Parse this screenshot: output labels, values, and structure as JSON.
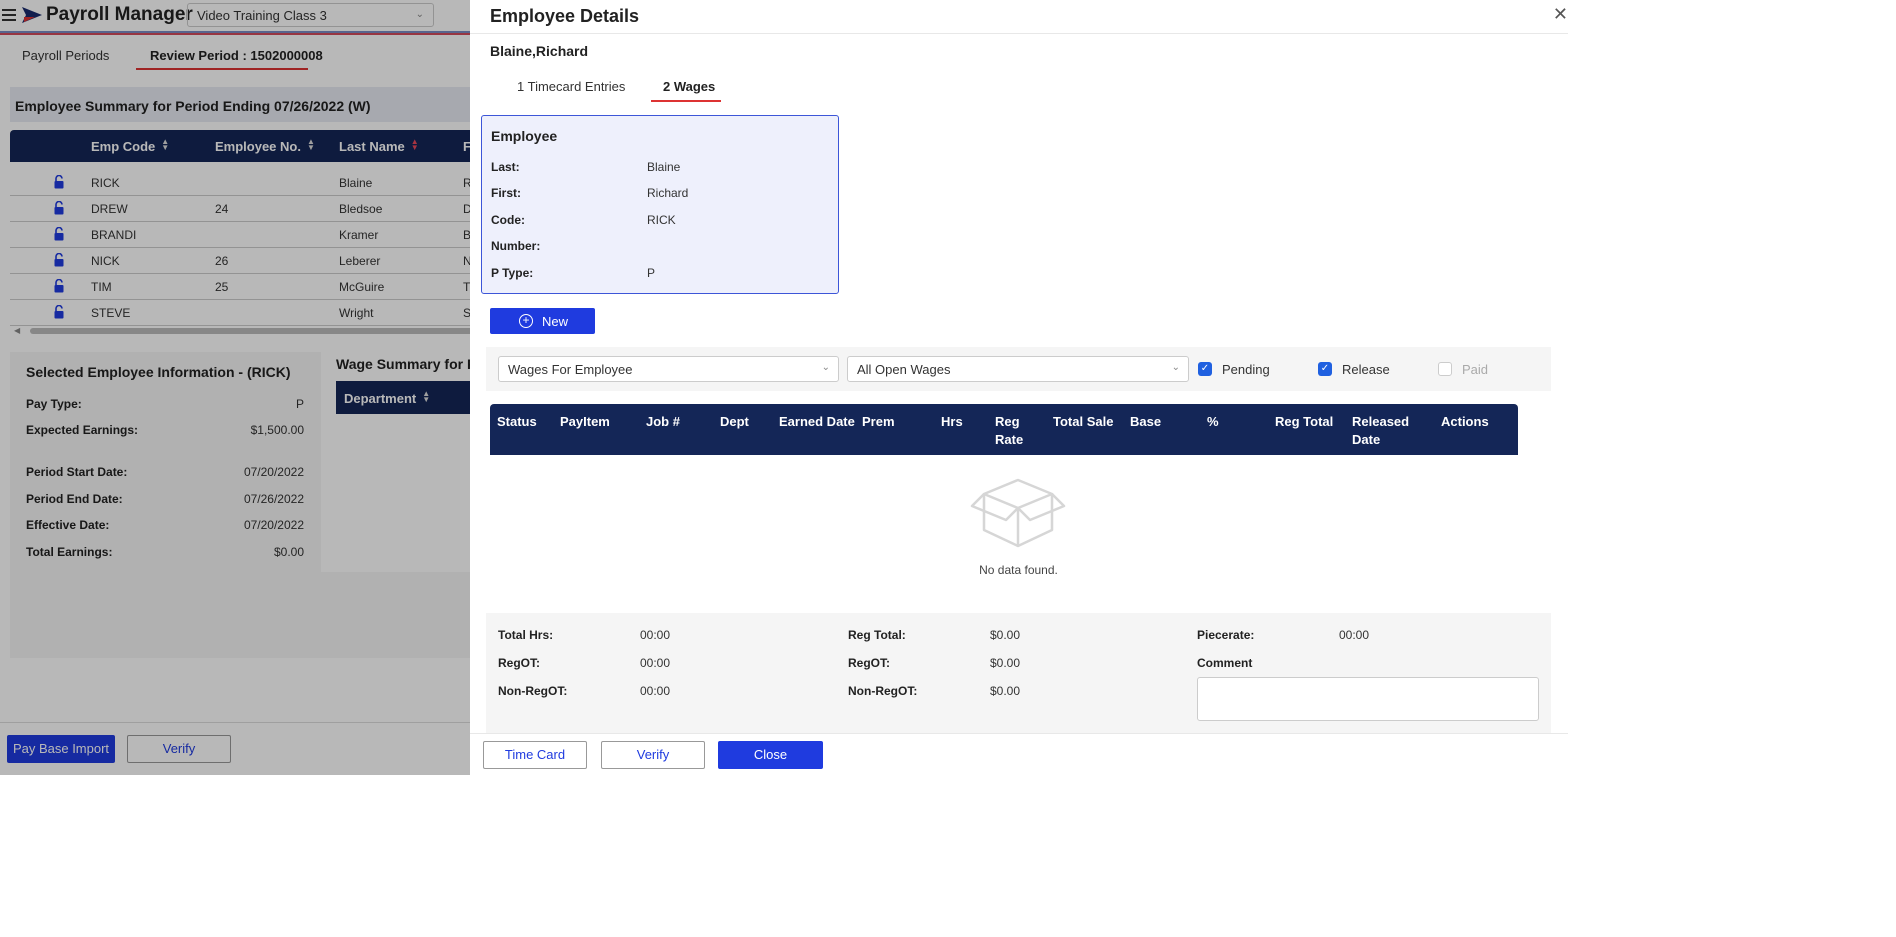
{
  "app": {
    "title": "Payroll Manager",
    "company_select": "Video Training Class 3"
  },
  "period_tabs": [
    {
      "label": "Payroll Periods"
    },
    {
      "label": "Review Period : 1502000008"
    }
  ],
  "summary": {
    "title": "Employee Summary for Period Ending 07/26/2022 (W)",
    "columns": [
      "Emp Code",
      "Employee No.",
      "Last Name",
      "F"
    ],
    "rows": [
      {
        "code": "RICK",
        "number": "",
        "last": "Blaine",
        "first": "R"
      },
      {
        "code": "DREW",
        "number": "24",
        "last": "Bledsoe",
        "first": "D"
      },
      {
        "code": "BRANDI",
        "number": "",
        "last": "Kramer",
        "first": "B"
      },
      {
        "code": "NICK",
        "number": "26",
        "last": "Leberer",
        "first": "N"
      },
      {
        "code": "TIM",
        "number": "25",
        "last": "McGuire",
        "first": "T"
      },
      {
        "code": "STEVE",
        "number": "",
        "last": "Wright",
        "first": "S"
      }
    ]
  },
  "selected_info": {
    "title": "Selected Employee Information - (RICK)",
    "fields": [
      {
        "label": "Pay Type:",
        "value": "P"
      },
      {
        "label": "Expected Earnings:",
        "value": "$1,500.00"
      },
      {
        "label": "Period Start Date:",
        "value": "07/20/2022"
      },
      {
        "label": "Period End Date:",
        "value": "07/26/2022"
      },
      {
        "label": "Effective Date:",
        "value": "07/20/2022"
      },
      {
        "label": "Total Earnings:",
        "value": "$0.00"
      }
    ]
  },
  "wage_summary": {
    "title": "Wage Summary for R",
    "column": "Department"
  },
  "bottom_buttons": {
    "pay_base_import": "Pay Base Import",
    "verify": "Verify"
  },
  "drawer": {
    "title": "Employee Details",
    "employee_name": "Blaine,Richard",
    "tabs": [
      {
        "label": "1 Timecard Entries"
      },
      {
        "label": "2 Wages"
      }
    ],
    "employee_card": {
      "title": "Employee",
      "fields": [
        {
          "label": "Last:",
          "value": "Blaine"
        },
        {
          "label": "First:",
          "value": "Richard"
        },
        {
          "label": "Code:",
          "value": "RICK"
        },
        {
          "label": "Number:",
          "value": ""
        },
        {
          "label": "P Type:",
          "value": "P"
        }
      ]
    },
    "new_button": "New",
    "filters": {
      "wages_for": "Wages For Employee",
      "open_wages": "All Open Wages",
      "pending": "Pending",
      "release": "Release",
      "paid": "Paid"
    },
    "wage_columns": [
      "Status",
      "PayItem",
      "Job #",
      "Dept",
      "Earned Date",
      "Prem",
      "Hrs",
      "Reg Rate",
      "Total Sale",
      "Base",
      "%",
      "Reg Total",
      "Released Date",
      "Actions"
    ],
    "no_data": "No data found.",
    "totals": {
      "total_hrs_label": "Total Hrs:",
      "total_hrs": "00:00",
      "regot_label": "RegOT:",
      "regot": "00:00",
      "nonregot_label": "Non-RegOT:",
      "nonregot": "00:00",
      "reg_total_label": "Reg Total:",
      "reg_total": "$0.00",
      "regot2_label": "RegOT:",
      "regot2": "$0.00",
      "nonregot2_label": "Non-RegOT:",
      "nonregot2": "$0.00",
      "piecerate_label": "Piecerate:",
      "piecerate": "00:00",
      "comment_label": "Comment"
    },
    "footer": {
      "time_card": "Time Card",
      "verify": "Verify",
      "close": "Close"
    }
  }
}
